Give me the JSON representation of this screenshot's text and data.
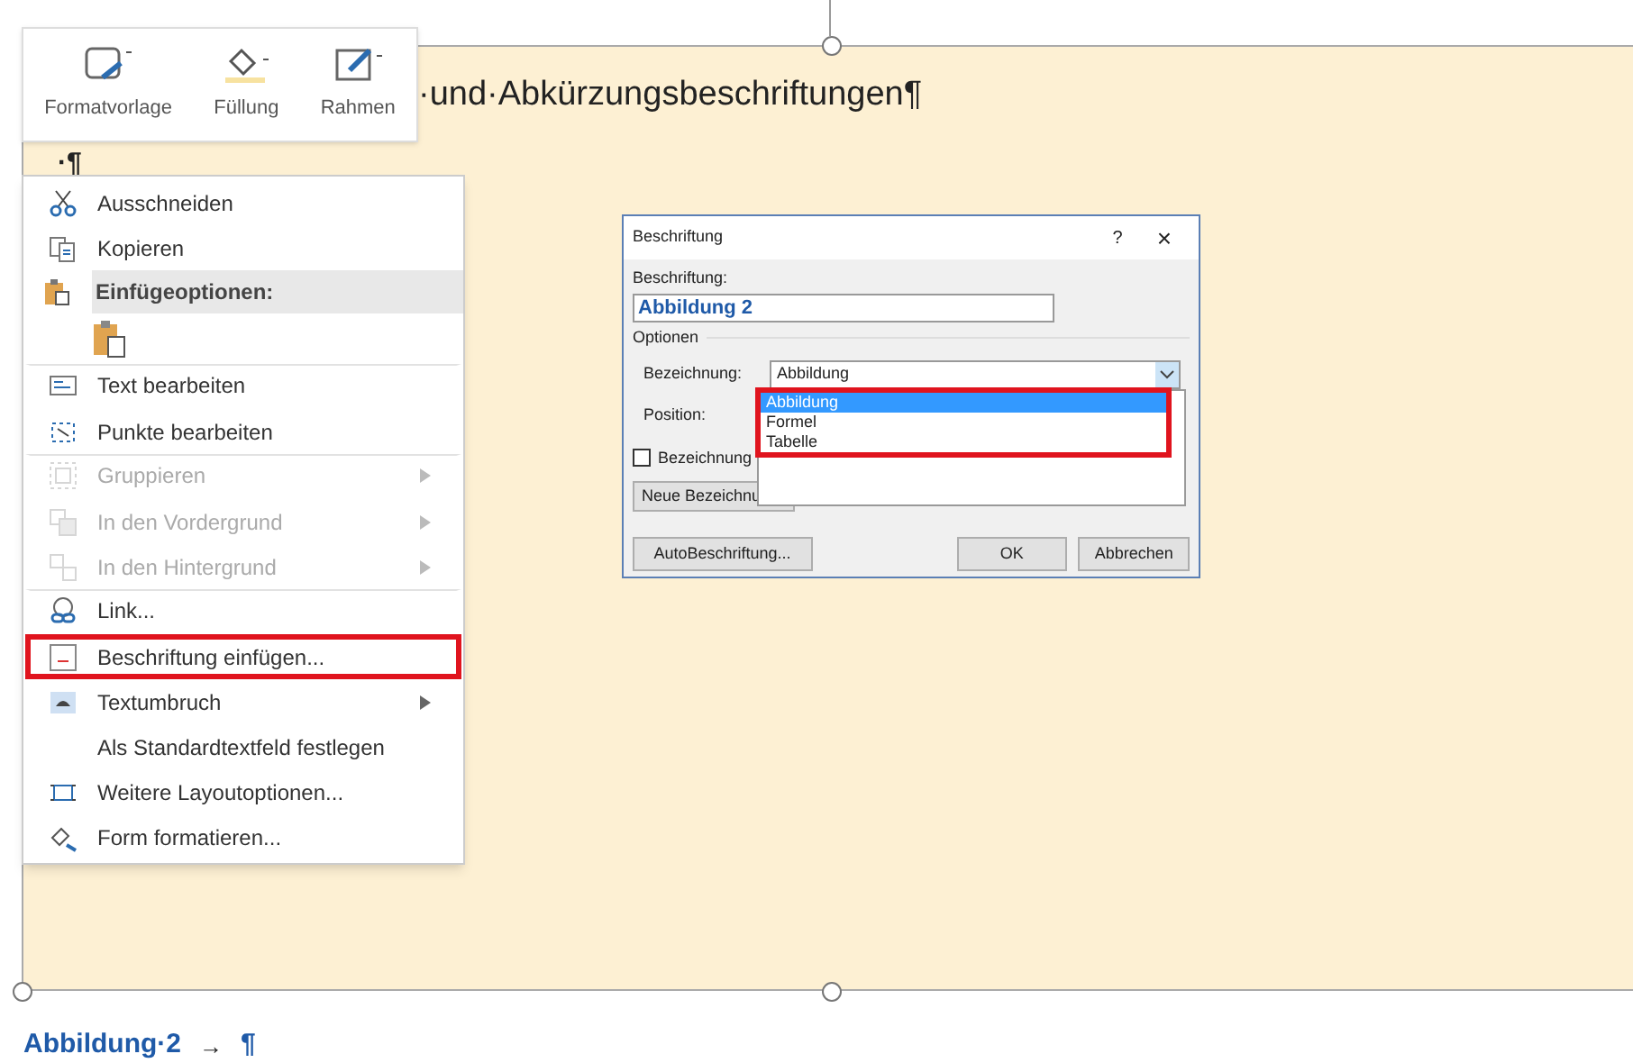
{
  "document": {
    "heading": "·und·Abkürzungsbeschriftungen¶",
    "paragraph_mark": "·¶",
    "caption": {
      "label": "Abbildung·2",
      "tab_arrow": "→",
      "pilcrow": "¶"
    }
  },
  "mini_toolbar": {
    "buttons": [
      {
        "label": "Formatvorlage"
      },
      {
        "label": "Füllung"
      },
      {
        "label": "Rahmen"
      }
    ]
  },
  "context_menu": {
    "items": [
      {
        "kind": "item",
        "label": "Ausschneiden",
        "disabled": false,
        "submenu": false,
        "highlighted": false,
        "separator_before": false
      },
      {
        "kind": "item",
        "label": "Kopieren",
        "disabled": false,
        "submenu": false,
        "highlighted": false,
        "separator_before": false
      },
      {
        "kind": "header",
        "label": "Einfügeoptionen:"
      },
      {
        "kind": "paste-options"
      },
      {
        "kind": "item",
        "label": "Text bearbeiten",
        "disabled": false,
        "submenu": false,
        "highlighted": false,
        "separator_before": true
      },
      {
        "kind": "item",
        "label": "Punkte bearbeiten",
        "disabled": false,
        "submenu": false,
        "highlighted": false,
        "separator_before": false
      },
      {
        "kind": "item",
        "label": "Gruppieren",
        "disabled": true,
        "submenu": true,
        "highlighted": false,
        "separator_before": true
      },
      {
        "kind": "item",
        "label": "In den Vordergrund",
        "disabled": true,
        "submenu": true,
        "highlighted": false,
        "separator_before": false
      },
      {
        "kind": "item",
        "label": "In den Hintergrund",
        "disabled": true,
        "submenu": true,
        "highlighted": false,
        "separator_before": false
      },
      {
        "kind": "item",
        "label": "Link...",
        "disabled": false,
        "submenu": false,
        "highlighted": false,
        "separator_before": true
      },
      {
        "kind": "item",
        "label": "Beschriftung einfügen...",
        "disabled": false,
        "submenu": false,
        "highlighted": true,
        "separator_before": false
      },
      {
        "kind": "item",
        "label": "Textumbruch",
        "disabled": false,
        "submenu": true,
        "highlighted": false,
        "separator_before": false
      },
      {
        "kind": "item",
        "label": "Als Standardtextfeld festlegen",
        "disabled": false,
        "submenu": false,
        "highlighted": false,
        "separator_before": false
      },
      {
        "kind": "item",
        "label": "Weitere Layoutoptionen...",
        "disabled": false,
        "submenu": false,
        "highlighted": false,
        "separator_before": false
      },
      {
        "kind": "item",
        "label": "Form formatieren...",
        "disabled": false,
        "submenu": false,
        "highlighted": false,
        "separator_before": false
      }
    ]
  },
  "dialog": {
    "title": "Beschriftung",
    "help": "?",
    "close": "×",
    "caption_label": "Beschriftung:",
    "caption_value": "Abbildung 2",
    "group": "Optionen",
    "label_field": {
      "label": "Bezeichnung:",
      "value": "Abbildung",
      "expanded": true,
      "highlighted": true,
      "options": [
        {
          "label": "Abbildung",
          "selected": true
        },
        {
          "label": "Formel",
          "selected": false
        },
        {
          "label": "Tabelle",
          "selected": false
        }
      ]
    },
    "position_label": "Position:",
    "exclude_checkbox": {
      "label": "Bezeichnung",
      "checked": false
    },
    "new_label_button": "Neue Bezeichnu",
    "buttons": [
      "AutoBeschriftung...",
      "OK",
      "Abbrechen"
    ]
  }
}
